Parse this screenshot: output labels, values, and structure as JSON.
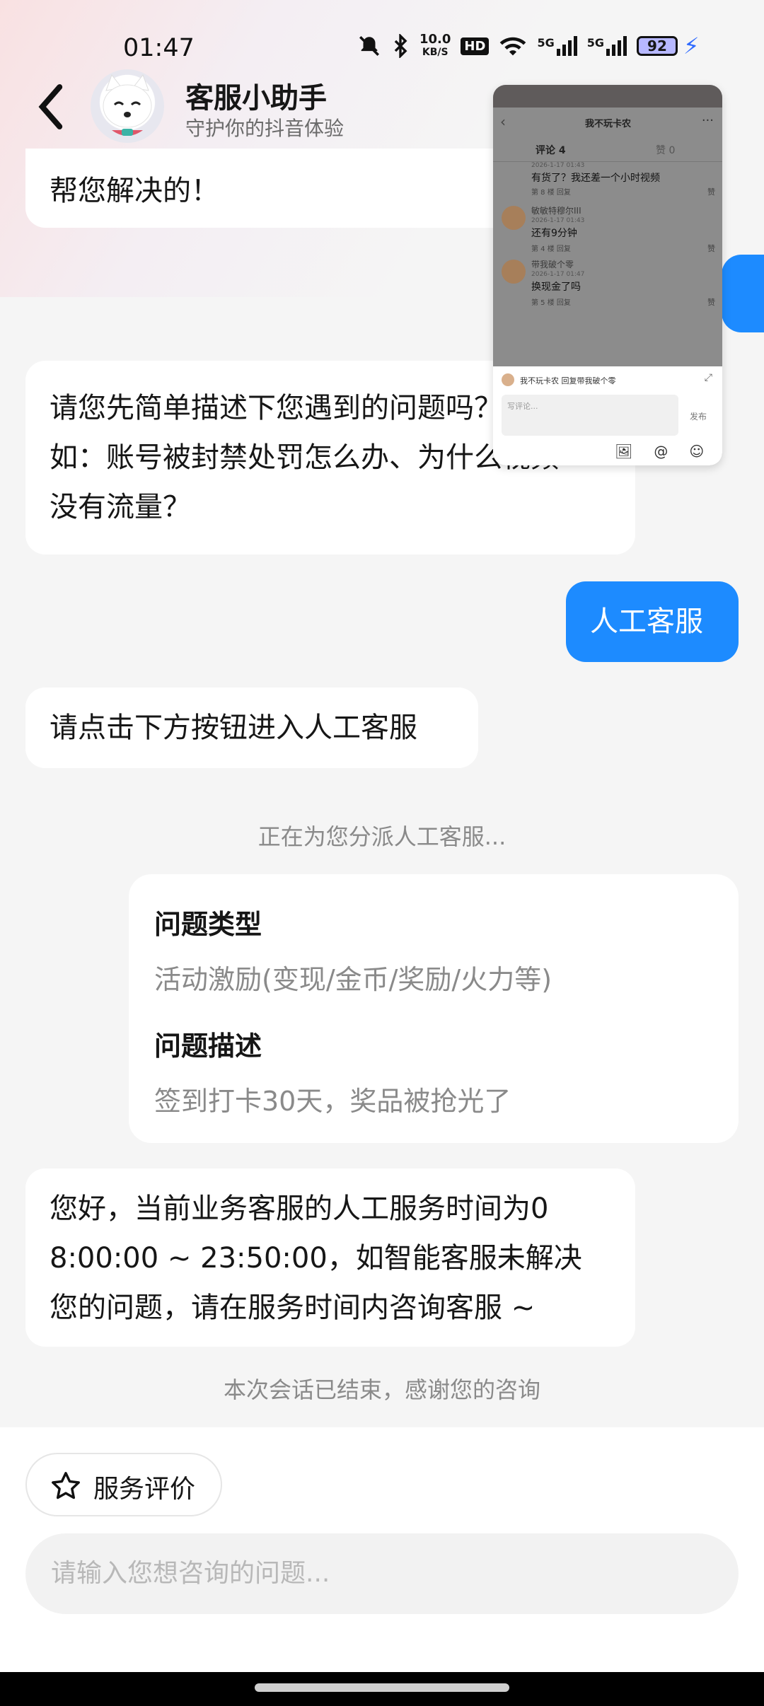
{
  "status_bar": {
    "time": "01:47",
    "net_speed": "10.0",
    "net_unit": "KB/S",
    "hd": "HD",
    "sig1": "5G",
    "sig2": "5G",
    "battery": "92"
  },
  "header": {
    "title": "客服小助手",
    "subtitle": "守护你的抖音体验"
  },
  "messages": [
    {
      "from": "bot",
      "text": "帮您解决的！"
    },
    {
      "from": "bot",
      "lines": [
        "请您先简单描述下您遇到的问题吗？",
        "如：账号被封禁处罚怎么办、为什么视频",
        "没有流量？"
      ]
    },
    {
      "from": "user",
      "text": "人工客服"
    },
    {
      "from": "bot",
      "text": "请点击下方按钮进入人工客服"
    },
    {
      "from": "system",
      "text": "正在为您分派人工客服..."
    },
    {
      "from": "bot",
      "lines": [
        "您好，当前业务客服的人工服务时间为0",
        "8:00:00 ~ 23:50:00，如智能客服未解决",
        "您的问题，请在服务时间内咨询客服 ~"
      ]
    },
    {
      "from": "system",
      "text": "本次会话已结束，感谢您的咨询"
    }
  ],
  "ticket_card": {
    "type_label": "问题类型",
    "type_value": "活动激励(变现/金币/奖励/火力等)",
    "desc_label": "问题描述",
    "desc_value": "签到打卡30天，奖品被抢光了"
  },
  "overlay_window": {
    "title": "我不玩卡农",
    "tab_comments": "评论 4",
    "tab_likes": "赞 0",
    "comments": [
      {
        "name": "",
        "date": "2026-1-17 01:43",
        "text": "有货了？我还差一个小时视频",
        "meta": "第 8 楼   回复",
        "like": "赞"
      },
      {
        "name": "敏敏特穆尔III",
        "date": "2026-1-17 01:43",
        "text": "还有9分钟",
        "meta": "第 4 楼   回复",
        "like": "赞"
      },
      {
        "name": "带我破个零",
        "date": "2026-1-17 01:47",
        "text": "换现金了吗",
        "meta": "第 5 楼   回复",
        "like": "赞"
      }
    ],
    "reply_to": "我不玩卡农  回复带我破个零",
    "input_placeholder": "写评论...",
    "publish": "发布"
  },
  "bottom": {
    "rate_label": "服务评价",
    "input_placeholder": "请输入您想咨询的问题..."
  },
  "colors": {
    "user_bubble": "#1d8bff",
    "background": "#f5f5f5"
  }
}
